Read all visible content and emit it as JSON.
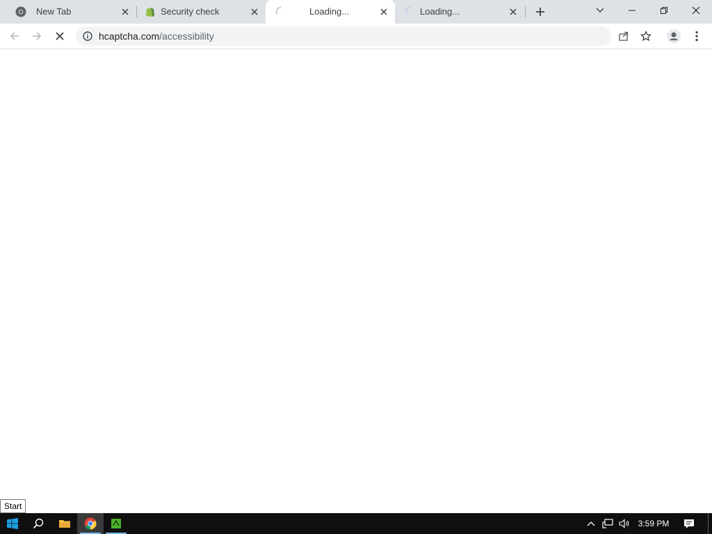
{
  "browser": {
    "tabs": [
      {
        "title": "New Tab",
        "favicon": "chrome-icon",
        "state": "inactive"
      },
      {
        "title": "Security check",
        "favicon": "shopify-bag-icon",
        "state": "inactive"
      },
      {
        "title": "Loading...",
        "favicon": "loading-spinner-icon",
        "state": "active"
      },
      {
        "title": "Loading...",
        "favicon": "loading-spinner-icon",
        "state": "inactive"
      }
    ],
    "address": {
      "host": "hcaptcha.com",
      "path": "/accessibility"
    }
  },
  "tooltip": {
    "text": "Start"
  },
  "taskbar": {
    "clock": "3:59 PM"
  },
  "colors": {
    "tabstrip_bg": "#dee1e6",
    "omnibox_bg": "#f1f3f4",
    "taskbar_bg": "#0f0f10",
    "windows_blue": "#1ba1e2"
  }
}
